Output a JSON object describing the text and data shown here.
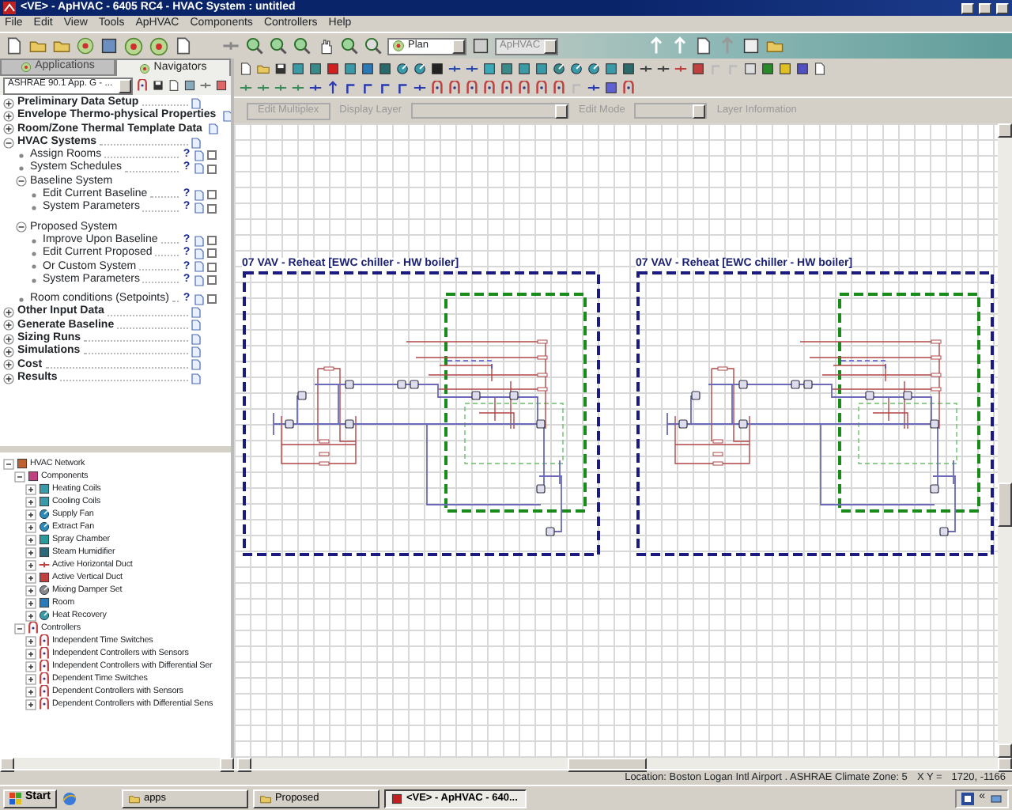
{
  "window": {
    "title": "<VE> - ApHVAC - 6405 RC4 - HVAC System : untitled"
  },
  "menu": [
    "File",
    "Edit",
    "View",
    "Tools",
    "ApHVAC",
    "Components",
    "Controllers",
    "Help"
  ],
  "toolbar": {
    "view_select": "Plan",
    "module_select": "ApHVAC",
    "module_disabled": true
  },
  "left_tabs": [
    {
      "label": "Applications",
      "selected": false
    },
    {
      "label": "Navigators",
      "selected": true
    }
  ],
  "workflow_select": "ASHRAE 90.1 App. G - ...",
  "navigator": [
    {
      "label": "Preliminary Data Setup",
      "kind": "section",
      "expanded": false
    },
    {
      "label": "Envelope Thermo-physical Properties",
      "kind": "section",
      "expanded": false
    },
    {
      "label": "Room/Zone Thermal Template Data",
      "kind": "section",
      "expanded": false
    },
    {
      "label": "HVAC Systems",
      "kind": "section",
      "expanded": true,
      "children": [
        {
          "label": "Assign Rooms",
          "kind": "step",
          "help": "?",
          "checked": false
        },
        {
          "label": "System Schedules",
          "kind": "step",
          "help": "?",
          "checked": false
        },
        {
          "label": "Baseline System",
          "kind": "group",
          "expanded": true,
          "children": [
            {
              "label": "Edit Current Baseline",
              "kind": "step",
              "help": "?",
              "checked": false
            },
            {
              "label": "System Parameters",
              "kind": "step",
              "help": "?",
              "checked": false
            }
          ]
        },
        {
          "label": "Proposed System",
          "kind": "group",
          "expanded": true,
          "children": [
            {
              "label": "Improve Upon Baseline",
              "kind": "step",
              "help": "?",
              "checked": false
            },
            {
              "label": "Edit Current Proposed",
              "kind": "step",
              "help": "?",
              "checked": false
            },
            {
              "label": "Or Custom System",
              "kind": "step",
              "help": "?",
              "checked": false
            },
            {
              "label": "System Parameters",
              "kind": "step",
              "help": "?",
              "checked": false
            }
          ]
        },
        {
          "label": "Room conditions (Setpoints)",
          "kind": "step",
          "help": "?",
          "checked": false
        }
      ]
    },
    {
      "label": "Other Input Data",
      "kind": "section",
      "expanded": false
    },
    {
      "label": "Generate Baseline",
      "kind": "section",
      "expanded": false
    },
    {
      "label": "Sizing Runs",
      "kind": "section",
      "expanded": false
    },
    {
      "label": "Simulations",
      "kind": "section",
      "expanded": false
    },
    {
      "label": "Cost",
      "kind": "section",
      "expanded": false
    },
    {
      "label": "Results",
      "kind": "section",
      "expanded": false
    }
  ],
  "layer_bar": [
    {
      "label": "Edit Multiplex",
      "kind": "button",
      "disabled": true
    },
    {
      "label": "Display Layer",
      "kind": "combo",
      "disabled": true
    },
    {
      "label": "Edit Mode",
      "kind": "combo",
      "disabled": true
    },
    {
      "label": "Layer Information",
      "kind": "label",
      "disabled": true
    }
  ],
  "diagrams": [
    {
      "title": "07 VAV - Reheat [EWC chiller - HW boiler]"
    },
    {
      "title": "07 VAV - Reheat [EWC chiller - HW boiler]"
    }
  ],
  "network": {
    "label": "HVAC Network",
    "expanded": true,
    "children": [
      {
        "label": "Components",
        "expanded": true,
        "children": [
          {
            "label": "Heating Coils",
            "expanded": false
          },
          {
            "label": "Cooling Coils",
            "expanded": false
          },
          {
            "label": "Supply Fan",
            "expanded": false
          },
          {
            "label": "Extract Fan",
            "expanded": false
          },
          {
            "label": "Spray Chamber",
            "expanded": false
          },
          {
            "label": "Steam Humidifier",
            "expanded": false
          },
          {
            "label": "Active Horizontal Duct",
            "expanded": false
          },
          {
            "label": "Active Vertical Duct",
            "expanded": false
          },
          {
            "label": "Mixing Damper Set",
            "expanded": false
          },
          {
            "label": "Room",
            "expanded": false
          },
          {
            "label": "Heat Recovery",
            "expanded": false
          }
        ]
      },
      {
        "label": "Controllers",
        "expanded": true,
        "children": [
          {
            "label": "Independent Time Switches",
            "expanded": false
          },
          {
            "label": "Independent Controllers with Sensors",
            "expanded": false
          },
          {
            "label": "Independent Controllers with Differential Ser",
            "expanded": false
          },
          {
            "label": "Dependent Time Switches",
            "expanded": false
          },
          {
            "label": "Dependent Controllers with Sensors",
            "expanded": false
          },
          {
            "label": "Dependent Controllers with Differential Sens",
            "expanded": false
          }
        ]
      }
    ]
  },
  "status_bar": {
    "location": "Location: Boston Logan Intl Airport . ASHRAE Climate Zone: 5",
    "coords_label": "X Y =",
    "coords": "1720, -1166"
  },
  "taskbar": {
    "start": "Start",
    "tasks": [
      {
        "label": "apps",
        "selected": false
      },
      {
        "label": "Proposed",
        "selected": false
      },
      {
        "label": "<VE> - ApHVAC - 640...",
        "selected": true
      }
    ],
    "tray": "«"
  }
}
